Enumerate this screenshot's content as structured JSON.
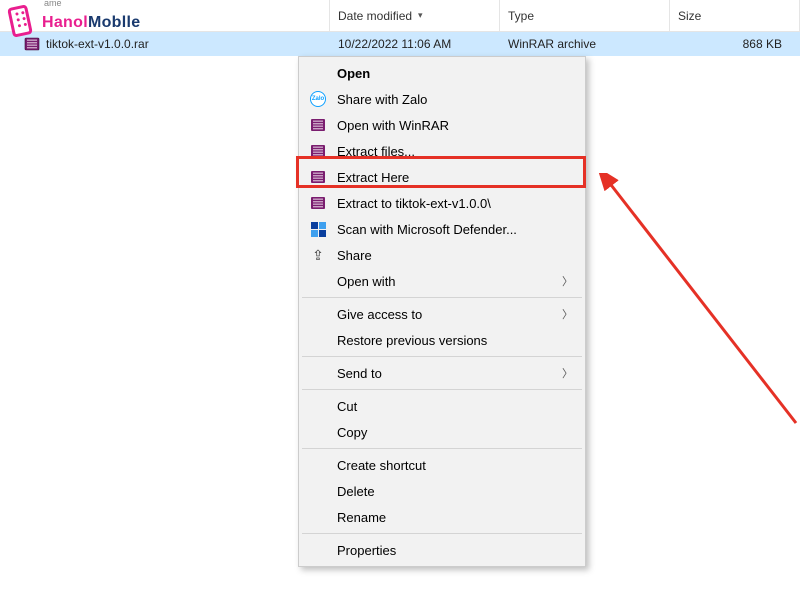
{
  "columns": {
    "name": "Name",
    "date": "Date modified",
    "type": "Type",
    "size": "Size"
  },
  "file": {
    "name": "tiktok-ext-v1.0.0.rar",
    "date": "10/22/2022 11:06 AM",
    "type": "WinRAR archive",
    "size": "868 KB"
  },
  "logo": {
    "sub": "ame",
    "brand_h": "Hanol",
    "brand_m": "Moblle"
  },
  "menu": {
    "open": "Open",
    "share_zalo": "Share with Zalo",
    "open_winrar": "Open with WinRAR",
    "extract_files": "Extract files...",
    "extract_here": "Extract Here",
    "extract_to": "Extract to tiktok-ext-v1.0.0\\",
    "defender": "Scan with Microsoft Defender...",
    "share": "Share",
    "open_with": "Open with",
    "give_access": "Give access to",
    "restore": "Restore previous versions",
    "send_to": "Send to",
    "cut": "Cut",
    "copy": "Copy",
    "shortcut": "Create shortcut",
    "delete": "Delete",
    "rename": "Rename",
    "properties": "Properties"
  }
}
